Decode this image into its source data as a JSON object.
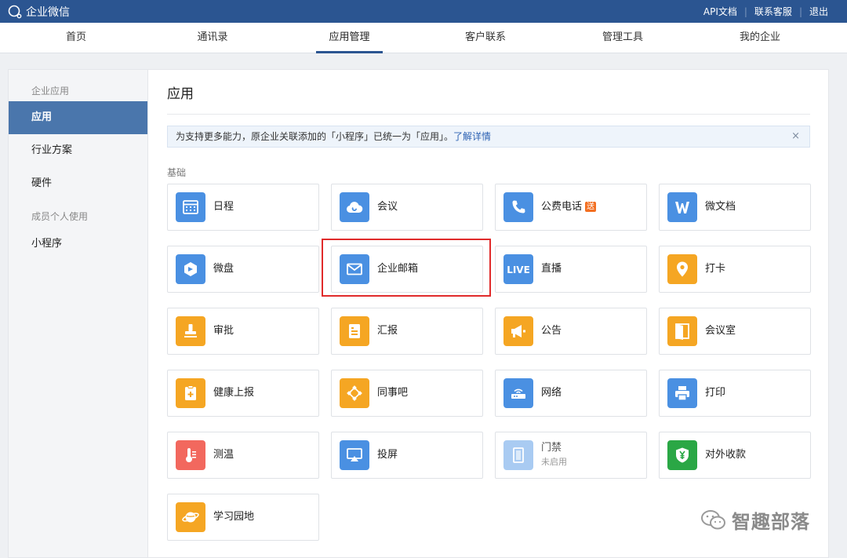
{
  "app": {
    "name": "企业微信"
  },
  "top_links": [
    "API文档",
    "联系客服",
    "退出"
  ],
  "nav": {
    "tabs": [
      {
        "label": "首页"
      },
      {
        "label": "通讯录"
      },
      {
        "label": "应用管理"
      },
      {
        "label": "客户联系"
      },
      {
        "label": "管理工具"
      },
      {
        "label": "我的企业"
      }
    ],
    "active": "应用管理"
  },
  "sidebar": {
    "group1": "企业应用",
    "items1": [
      {
        "label": "应用"
      },
      {
        "label": "行业方案"
      },
      {
        "label": "硬件"
      }
    ],
    "group2": "成员个人使用",
    "items2": [
      {
        "label": "小程序"
      }
    ],
    "active": "应用"
  },
  "main": {
    "title": "应用",
    "notice": {
      "text": "为支持更多能力，原企业关联添加的「小程序」已统一为「应用」。",
      "link": "了解详情",
      "close": "×"
    },
    "section": "基础",
    "apps": [
      {
        "label": "日程",
        "icon": "calendar-icon",
        "color": "#4a90e2"
      },
      {
        "label": "会议",
        "icon": "cloud-meeting-icon",
        "color": "#4a90e2"
      },
      {
        "label": "公费电话",
        "icon": "phone-icon",
        "color": "#4a90e2",
        "badge": "送"
      },
      {
        "label": "微文档",
        "icon": "w-document-icon",
        "color": "#4a90e2"
      },
      {
        "label": "微盘",
        "icon": "drive-icon",
        "color": "#4a90e2"
      },
      {
        "label": "企业邮箱",
        "icon": "mail-icon",
        "color": "#4a90e2"
      },
      {
        "label": "直播",
        "icon": "live-icon",
        "color": "#4a90e2"
      },
      {
        "label": "打卡",
        "icon": "location-pin-icon",
        "color": "#f5a623"
      },
      {
        "label": "审批",
        "icon": "stamp-icon",
        "color": "#f5a623"
      },
      {
        "label": "汇报",
        "icon": "report-icon",
        "color": "#f5a623"
      },
      {
        "label": "公告",
        "icon": "megaphone-icon",
        "color": "#f5a623"
      },
      {
        "label": "会议室",
        "icon": "door-icon",
        "color": "#f5a623"
      },
      {
        "label": "健康上报",
        "icon": "health-clipboard-icon",
        "color": "#f5a623"
      },
      {
        "label": "同事吧",
        "icon": "network-icon",
        "color": "#f5a623"
      },
      {
        "label": "网络",
        "icon": "router-icon",
        "color": "#4a90e2"
      },
      {
        "label": "打印",
        "icon": "printer-icon",
        "color": "#4a90e2"
      },
      {
        "label": "测温",
        "icon": "thermometer-icon",
        "color": "#f2685e"
      },
      {
        "label": "投屏",
        "icon": "screen-cast-icon",
        "color": "#4a90e2"
      },
      {
        "label": "门禁",
        "sub": "未启用",
        "icon": "access-door-icon",
        "color": "#a9cbf2",
        "disabled": true
      },
      {
        "label": "对外收款",
        "icon": "yuan-shield-icon",
        "color": "#2aa745"
      },
      {
        "label": "学习园地",
        "icon": "planet-icon",
        "color": "#f5a623"
      }
    ]
  },
  "watermark": {
    "text": "智趣部落"
  }
}
